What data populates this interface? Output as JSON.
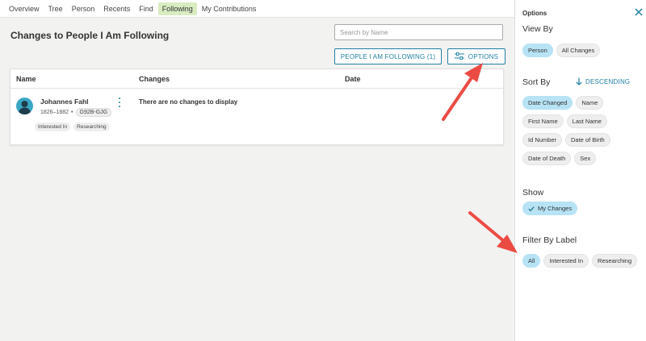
{
  "topnav": {
    "items": [
      "Overview",
      "Tree",
      "Person",
      "Recents",
      "Find",
      "Following",
      "My Contributions"
    ],
    "active": "Following"
  },
  "main": {
    "title": "Changes to People I Am Following",
    "search_placeholder": "Search by Name",
    "following_button": "PEOPLE I AM FOLLOWING (1)",
    "options_button": "OPTIONS",
    "columns": [
      "Name",
      "Changes",
      "Date"
    ],
    "person": {
      "name": "Johannes Fahl",
      "dates": "1826–1882",
      "separator": "•",
      "id": "G92B-GJG",
      "labels": [
        "Interested In",
        "Researching"
      ]
    },
    "no_changes": "There are no changes to display"
  },
  "panel": {
    "title": "Options",
    "view_by": {
      "title": "View By",
      "options": [
        "Person",
        "All Changes"
      ],
      "selected": "Person"
    },
    "sort_by": {
      "title": "Sort By",
      "direction": "DESCENDING",
      "options": [
        "Date Changed",
        "Name",
        "First Name",
        "Last Name",
        "Id Number",
        "Date of Birth",
        "Date of Death",
        "Sex"
      ],
      "selected": "Date Changed"
    },
    "show": {
      "title": "Show",
      "option": "My Changes"
    },
    "filter": {
      "title": "Filter By Label",
      "options": [
        "All",
        "Interested In",
        "Researching"
      ],
      "selected": "All"
    }
  },
  "colors": {
    "accent": "#1f80a3",
    "selected_chip": "#b7e3f5",
    "active_nav": "#d9ecc2",
    "annotation_arrow": "#ec4b44"
  }
}
